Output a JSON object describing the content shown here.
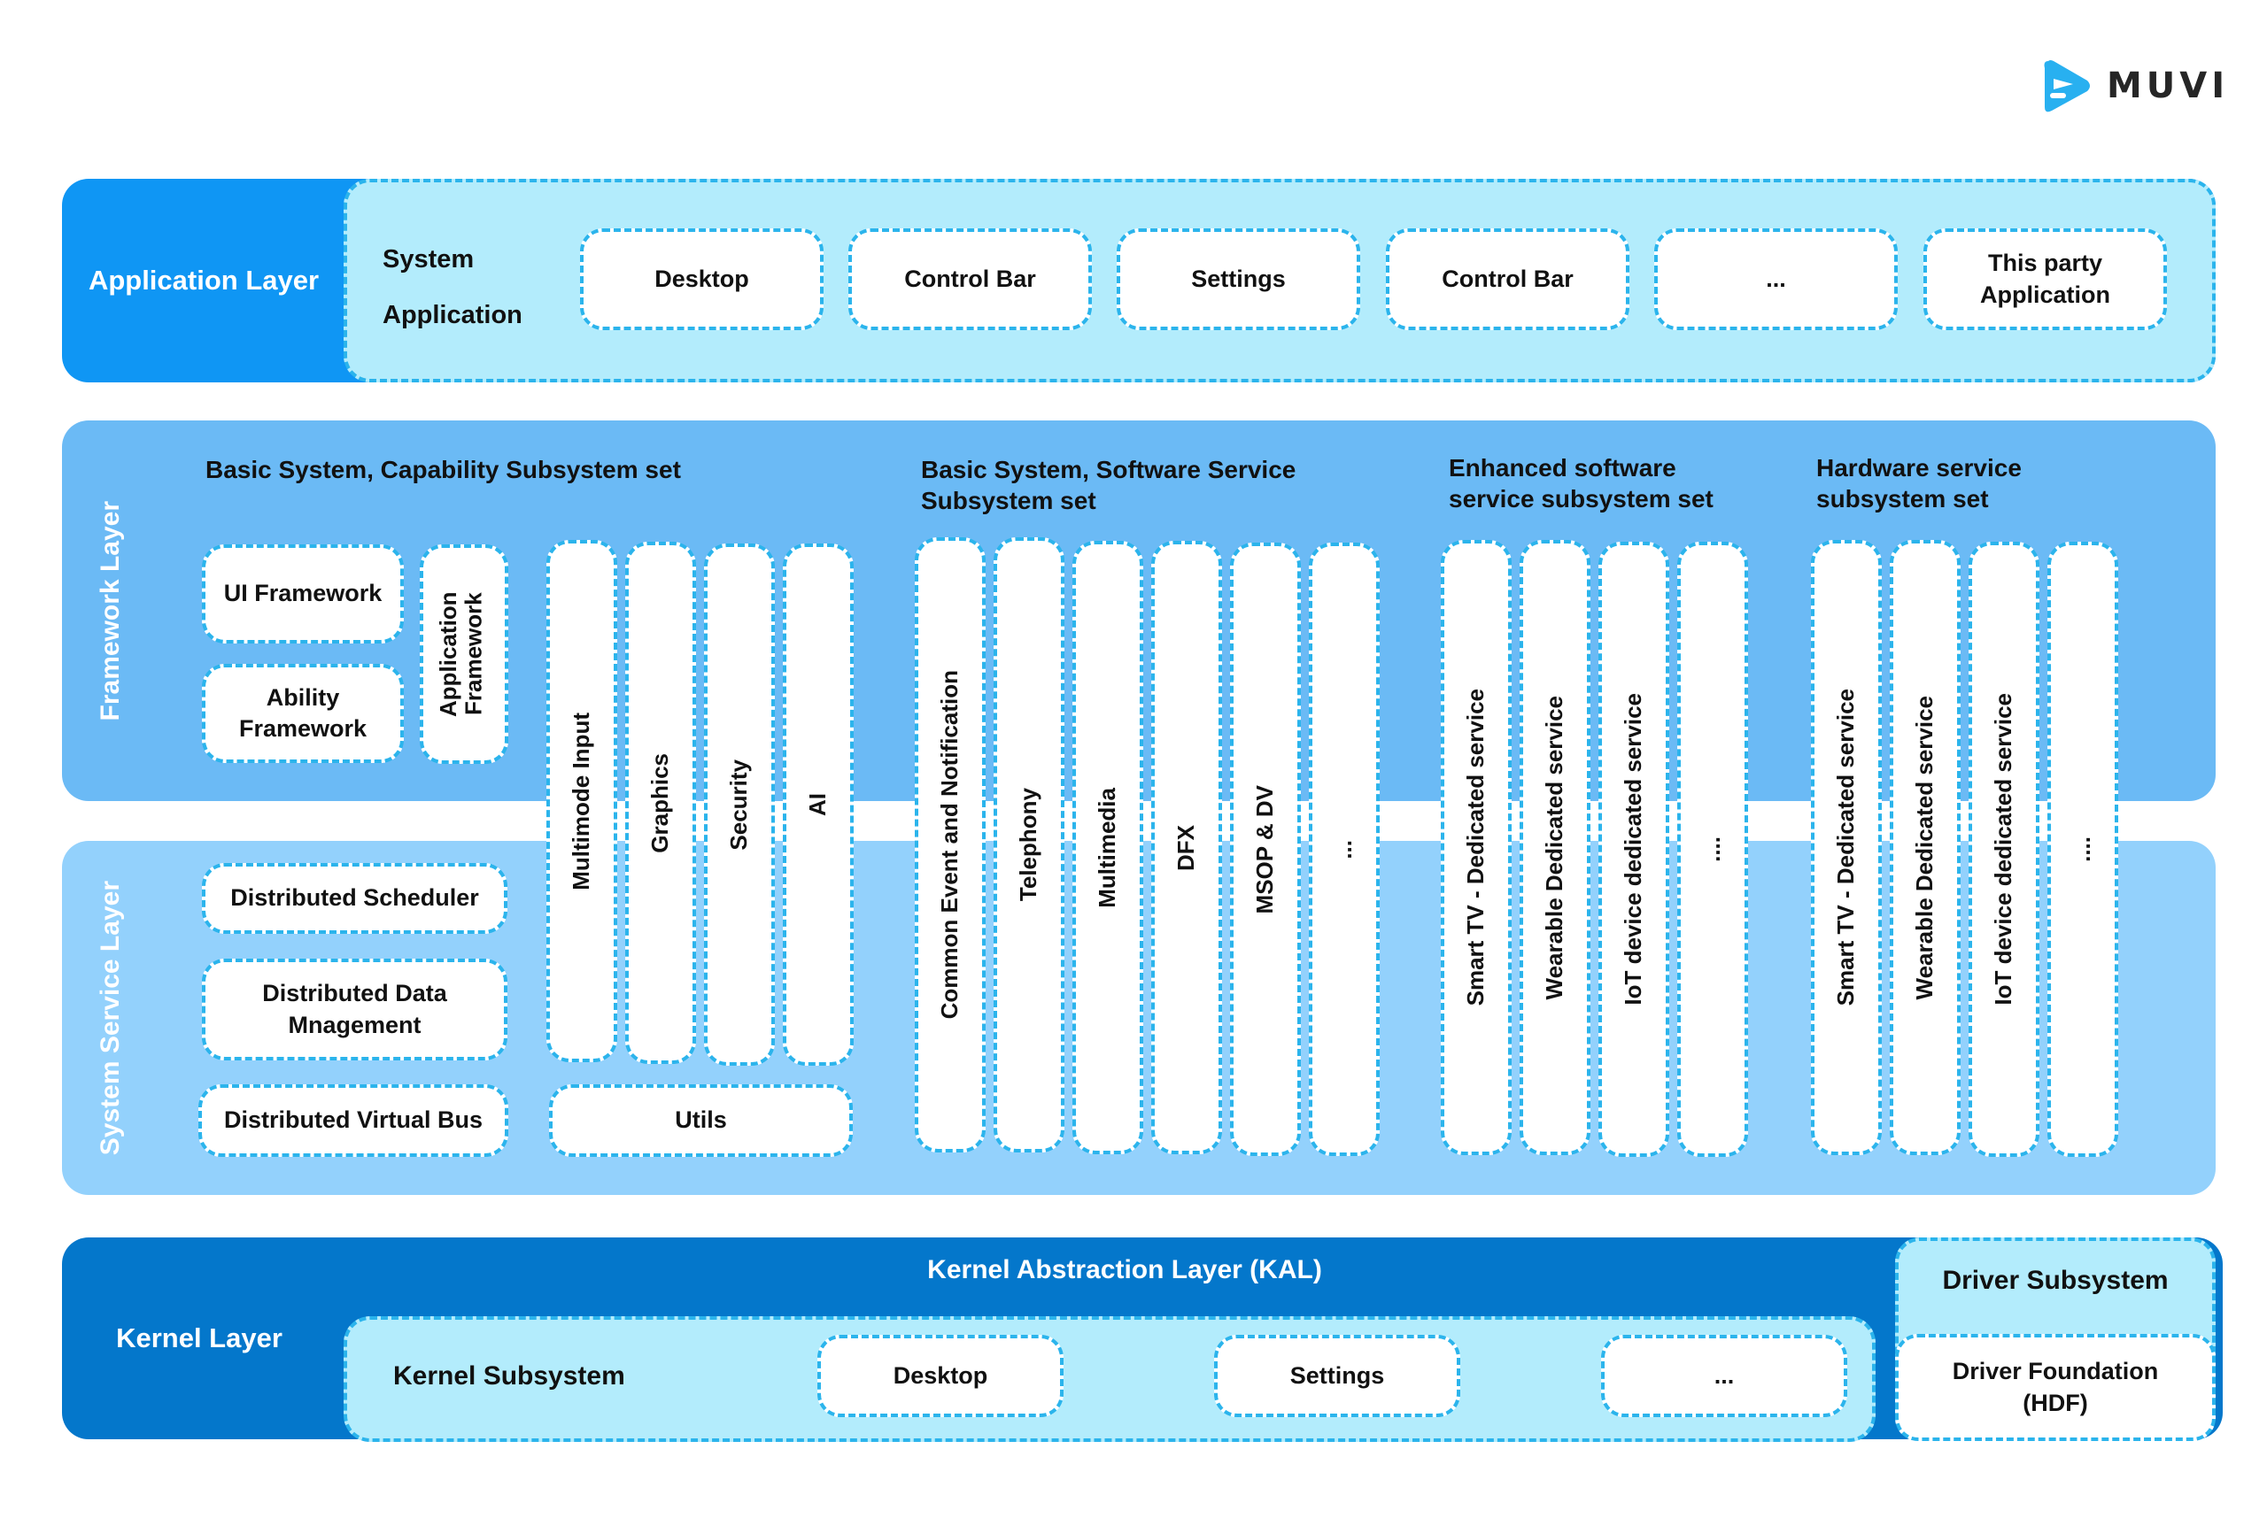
{
  "logo": {
    "text": "MUVI",
    "icon": "muvi-logo-icon",
    "brand_color": "#28b0f0"
  },
  "colors": {
    "application_layer": "#0f96f4",
    "framework_layer": "#6bbaf5",
    "system_service_layer": "#93d1fc",
    "kernel_layer": "#0477cb",
    "inner_panel": "#b3ecfc",
    "dashed_border": "#2bb4ec"
  },
  "application_layer": {
    "label": "Application Layer",
    "group_label_line1": "System",
    "group_label_line2": "Application",
    "items": [
      "Desktop",
      "Control Bar",
      "Settings",
      "Control Bar",
      "...",
      "This party Application"
    ]
  },
  "framework_layer": {
    "label": "Framework Layer",
    "groups": [
      {
        "title": "Basic System, Capability Subsystem set"
      },
      {
        "title": "Basic System, Software Service Subsystem set"
      },
      {
        "title": "Enhanced software service subsystem set"
      },
      {
        "title": "Hardware service subsystem set"
      }
    ],
    "framework_boxes": [
      "UI Framework",
      "Ability Framework",
      "Application Framework"
    ]
  },
  "system_service_layer": {
    "label": "System Service Layer",
    "boxes": [
      "Distributed Scheduler",
      "Distributed Data Mnagement",
      "Distributed Virtual Bus",
      "Utils"
    ]
  },
  "columns": {
    "capability": [
      "Multimode Input",
      "Graphics",
      "Security",
      "AI"
    ],
    "software_service": [
      "Common Event and Notification",
      "Telephony",
      "Multimedia",
      "DFX",
      "MSOP & DV",
      "..."
    ],
    "enhanced_software": [
      "Smart TV - Dedicated service",
      "Wearable Dedicated service",
      "IoT device dedicated service",
      "...."
    ],
    "hardware_service": [
      "Smart TV - Dedicated service",
      "Wearable Dedicated service",
      "IoT device dedicated service",
      "...."
    ]
  },
  "kernel_layer": {
    "label": "Kernel Layer",
    "kal_title": "Kernel Abstraction Layer (KAL)",
    "kernel_subsystem_label": "Kernel Subsystem",
    "items": [
      "Desktop",
      "Settings",
      "..."
    ],
    "driver_subsystem_label": "Driver Subsystem",
    "driver_foundation_label": "Driver Foundation (HDF)"
  }
}
